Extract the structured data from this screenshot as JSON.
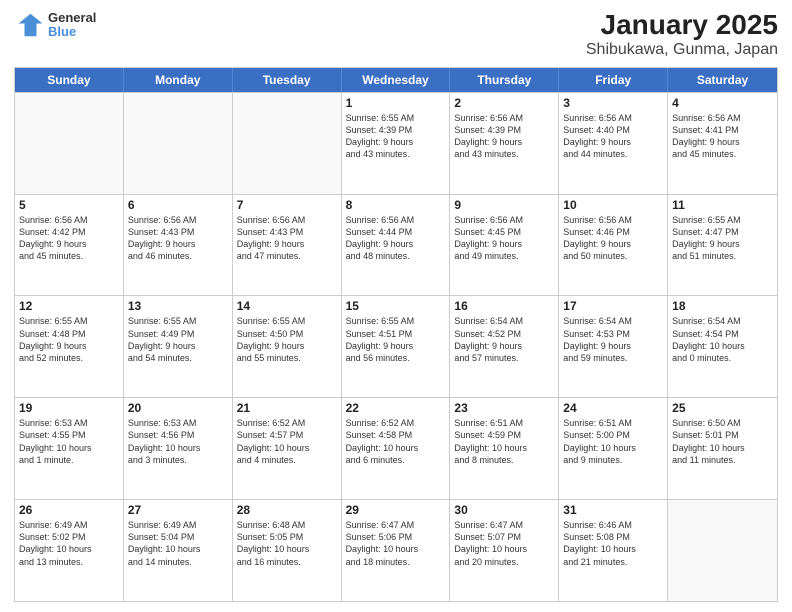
{
  "header": {
    "logo": {
      "line1": "General",
      "line2": "Blue"
    },
    "title": "January 2025",
    "subtitle": "Shibukawa, Gunma, Japan"
  },
  "weekdays": [
    "Sunday",
    "Monday",
    "Tuesday",
    "Wednesday",
    "Thursday",
    "Friday",
    "Saturday"
  ],
  "rows": [
    [
      {
        "day": "",
        "text": ""
      },
      {
        "day": "",
        "text": ""
      },
      {
        "day": "",
        "text": ""
      },
      {
        "day": "1",
        "text": "Sunrise: 6:55 AM\nSunset: 4:39 PM\nDaylight: 9 hours\nand 43 minutes."
      },
      {
        "day": "2",
        "text": "Sunrise: 6:56 AM\nSunset: 4:39 PM\nDaylight: 9 hours\nand 43 minutes."
      },
      {
        "day": "3",
        "text": "Sunrise: 6:56 AM\nSunset: 4:40 PM\nDaylight: 9 hours\nand 44 minutes."
      },
      {
        "day": "4",
        "text": "Sunrise: 6:56 AM\nSunset: 4:41 PM\nDaylight: 9 hours\nand 45 minutes."
      }
    ],
    [
      {
        "day": "5",
        "text": "Sunrise: 6:56 AM\nSunset: 4:42 PM\nDaylight: 9 hours\nand 45 minutes."
      },
      {
        "day": "6",
        "text": "Sunrise: 6:56 AM\nSunset: 4:43 PM\nDaylight: 9 hours\nand 46 minutes."
      },
      {
        "day": "7",
        "text": "Sunrise: 6:56 AM\nSunset: 4:43 PM\nDaylight: 9 hours\nand 47 minutes."
      },
      {
        "day": "8",
        "text": "Sunrise: 6:56 AM\nSunset: 4:44 PM\nDaylight: 9 hours\nand 48 minutes."
      },
      {
        "day": "9",
        "text": "Sunrise: 6:56 AM\nSunset: 4:45 PM\nDaylight: 9 hours\nand 49 minutes."
      },
      {
        "day": "10",
        "text": "Sunrise: 6:56 AM\nSunset: 4:46 PM\nDaylight: 9 hours\nand 50 minutes."
      },
      {
        "day": "11",
        "text": "Sunrise: 6:55 AM\nSunset: 4:47 PM\nDaylight: 9 hours\nand 51 minutes."
      }
    ],
    [
      {
        "day": "12",
        "text": "Sunrise: 6:55 AM\nSunset: 4:48 PM\nDaylight: 9 hours\nand 52 minutes."
      },
      {
        "day": "13",
        "text": "Sunrise: 6:55 AM\nSunset: 4:49 PM\nDaylight: 9 hours\nand 54 minutes."
      },
      {
        "day": "14",
        "text": "Sunrise: 6:55 AM\nSunset: 4:50 PM\nDaylight: 9 hours\nand 55 minutes."
      },
      {
        "day": "15",
        "text": "Sunrise: 6:55 AM\nSunset: 4:51 PM\nDaylight: 9 hours\nand 56 minutes."
      },
      {
        "day": "16",
        "text": "Sunrise: 6:54 AM\nSunset: 4:52 PM\nDaylight: 9 hours\nand 57 minutes."
      },
      {
        "day": "17",
        "text": "Sunrise: 6:54 AM\nSunset: 4:53 PM\nDaylight: 9 hours\nand 59 minutes."
      },
      {
        "day": "18",
        "text": "Sunrise: 6:54 AM\nSunset: 4:54 PM\nDaylight: 10 hours\nand 0 minutes."
      }
    ],
    [
      {
        "day": "19",
        "text": "Sunrise: 6:53 AM\nSunset: 4:55 PM\nDaylight: 10 hours\nand 1 minute."
      },
      {
        "day": "20",
        "text": "Sunrise: 6:53 AM\nSunset: 4:56 PM\nDaylight: 10 hours\nand 3 minutes."
      },
      {
        "day": "21",
        "text": "Sunrise: 6:52 AM\nSunset: 4:57 PM\nDaylight: 10 hours\nand 4 minutes."
      },
      {
        "day": "22",
        "text": "Sunrise: 6:52 AM\nSunset: 4:58 PM\nDaylight: 10 hours\nand 6 minutes."
      },
      {
        "day": "23",
        "text": "Sunrise: 6:51 AM\nSunset: 4:59 PM\nDaylight: 10 hours\nand 8 minutes."
      },
      {
        "day": "24",
        "text": "Sunrise: 6:51 AM\nSunset: 5:00 PM\nDaylight: 10 hours\nand 9 minutes."
      },
      {
        "day": "25",
        "text": "Sunrise: 6:50 AM\nSunset: 5:01 PM\nDaylight: 10 hours\nand 11 minutes."
      }
    ],
    [
      {
        "day": "26",
        "text": "Sunrise: 6:49 AM\nSunset: 5:02 PM\nDaylight: 10 hours\nand 13 minutes."
      },
      {
        "day": "27",
        "text": "Sunrise: 6:49 AM\nSunset: 5:04 PM\nDaylight: 10 hours\nand 14 minutes."
      },
      {
        "day": "28",
        "text": "Sunrise: 6:48 AM\nSunset: 5:05 PM\nDaylight: 10 hours\nand 16 minutes."
      },
      {
        "day": "29",
        "text": "Sunrise: 6:47 AM\nSunset: 5:06 PM\nDaylight: 10 hours\nand 18 minutes."
      },
      {
        "day": "30",
        "text": "Sunrise: 6:47 AM\nSunset: 5:07 PM\nDaylight: 10 hours\nand 20 minutes."
      },
      {
        "day": "31",
        "text": "Sunrise: 6:46 AM\nSunset: 5:08 PM\nDaylight: 10 hours\nand 21 minutes."
      },
      {
        "day": "",
        "text": ""
      }
    ]
  ]
}
